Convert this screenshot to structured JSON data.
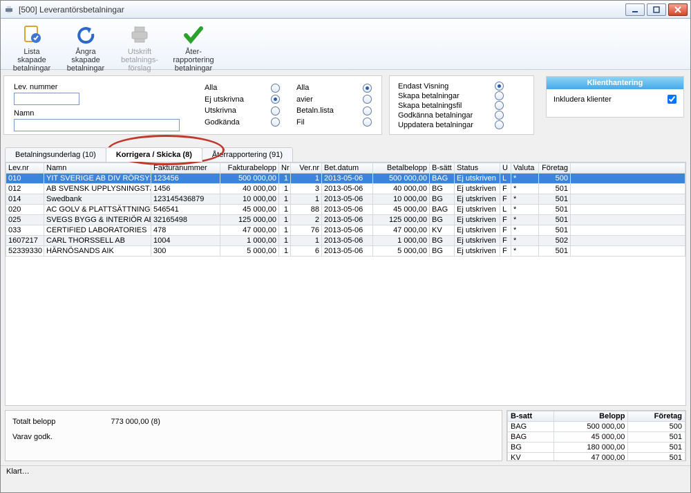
{
  "window": {
    "icon": "printer-icon",
    "title": "[500]  Leverantörsbetalningar"
  },
  "toolbar": {
    "items": [
      {
        "label": "Lista\nskapade\nbetalningar",
        "icon": "list-doc-icon",
        "enabled": true
      },
      {
        "label": "Ångra\nskapade\nbetalningar",
        "icon": "undo-icon",
        "enabled": true
      },
      {
        "label": "Utskrift\nbetalnings-\nförslag",
        "icon": "print-icon",
        "enabled": false
      },
      {
        "label": "Åter-\nrapportering\nbetalningar",
        "icon": "check-icon",
        "enabled": true
      }
    ]
  },
  "filters": {
    "lev_nummer_label": "Lev. nummer",
    "lev_nummer": "",
    "namn_label": "Namn",
    "namn": "",
    "group1": [
      {
        "label": "Alla",
        "checked": false
      },
      {
        "label": "Ej utskrivna",
        "checked": true
      },
      {
        "label": "Utskrivna",
        "checked": false
      },
      {
        "label": "Godkända",
        "checked": false
      }
    ],
    "group2": [
      {
        "label": "Alla",
        "checked": true
      },
      {
        "label": "avier",
        "checked": false
      },
      {
        "label": "Betaln.lista",
        "checked": false
      },
      {
        "label": "Fil",
        "checked": false
      }
    ]
  },
  "options": [
    {
      "label": "Endast Visning",
      "checked": true
    },
    {
      "label": "Skapa betalningar",
      "checked": false
    },
    {
      "label": "Skapa betalningsfil",
      "checked": false
    },
    {
      "label": "Godkänna betalningar",
      "checked": false
    },
    {
      "label": "Uppdatera betalningar",
      "checked": false
    }
  ],
  "sidebox": {
    "title": "Klienthantering",
    "chk_label": "Inkludera klienter",
    "chk": true
  },
  "tabs": [
    {
      "label": "Betalningsunderlag (10)",
      "active": false
    },
    {
      "label": "Korrigera / Skicka (8)",
      "active": true
    },
    {
      "label": "Återrapportering (91)",
      "active": false
    }
  ],
  "grid": {
    "headers": [
      "Lev.nr",
      "Namn",
      "Fakturanummer",
      "Fakturabelopp",
      "Nr",
      "Ver.nr",
      "Bet.datum",
      "Betalbelopp",
      "B-sätt",
      "Status",
      "U",
      "Valuta",
      "Företag"
    ],
    "align": [
      "l",
      "l",
      "l",
      "r",
      "r",
      "r",
      "l",
      "r",
      "l",
      "l",
      "l",
      "l",
      "r"
    ],
    "widths": [
      55,
      155,
      100,
      85,
      17,
      45,
      74,
      82,
      36,
      66,
      16,
      40,
      46
    ],
    "rows": [
      {
        "sel": true,
        "cells": [
          "010",
          "YIT SVERIGE AB DIV RÖRSYS",
          "123456",
          "500 000,00",
          "1",
          "1",
          "2013-05-06",
          "500 000,00",
          "BAG",
          "Ej utskriven",
          "L",
          "*",
          "500"
        ]
      },
      {
        "sel": false,
        "cells": [
          "012",
          "AB SVENSK UPPLYSNINGSTJ",
          "1456",
          "40 000,00",
          "1",
          "3",
          "2013-05-06",
          "40 000,00",
          "BG",
          "Ej utskriven",
          "F",
          "*",
          "501"
        ]
      },
      {
        "sel": false,
        "alt": true,
        "cells": [
          "014",
          "Swedbank",
          "123145436879",
          "10 000,00",
          "1",
          "1",
          "2013-05-06",
          "10 000,00",
          "BG",
          "Ej utskriven",
          "F",
          "*",
          "501"
        ]
      },
      {
        "sel": false,
        "cells": [
          "020",
          "AC GOLV & PLATTSÄTTNING",
          "546541",
          "45 000,00",
          "1",
          "88",
          "2013-05-06",
          "45 000,00",
          "BAG",
          "Ej utskriven",
          "L",
          "*",
          "501"
        ]
      },
      {
        "sel": false,
        "alt": true,
        "cells": [
          "025",
          "SVEGS BYGG & INTERIÖR AB",
          "32165498",
          "125 000,00",
          "1",
          "2",
          "2013-05-06",
          "125 000,00",
          "BG",
          "Ej utskriven",
          "F",
          "*",
          "501"
        ]
      },
      {
        "sel": false,
        "cells": [
          "033",
          "CERTIFIED LABORATORIES",
          "478",
          "47 000,00",
          "1",
          "76",
          "2013-05-06",
          "47 000,00",
          "KV",
          "Ej utskriven",
          "F",
          "*",
          "501"
        ]
      },
      {
        "sel": false,
        "alt": true,
        "cells": [
          "1607217",
          "CARL THORSSELL AB",
          "1004",
          "1 000,00",
          "1",
          "1",
          "2013-05-06",
          "1 000,00",
          "BG",
          "Ej utskriven",
          "F",
          "*",
          "502"
        ]
      },
      {
        "sel": false,
        "cells": [
          "52339330",
          "HÄRNÖSANDS AIK",
          "300",
          "5 000,00",
          "1",
          "6",
          "2013-05-06",
          "5 000,00",
          "BG",
          "Ej utskriven",
          "F",
          "*",
          "501"
        ]
      }
    ]
  },
  "totals": {
    "label1": "Totalt belopp",
    "value1": "773 000,00 (8)",
    "label2": "Varav godk."
  },
  "summary": {
    "headers": [
      "B-satt",
      "Belopp",
      "Företag"
    ],
    "rows": [
      [
        "BAG",
        "500 000,00",
        "500"
      ],
      [
        "BAG",
        "45 000,00",
        "501"
      ],
      [
        "BG",
        "180 000,00",
        "501"
      ],
      [
        "KV",
        "47 000,00",
        "501"
      ]
    ]
  },
  "status": "Klart…"
}
